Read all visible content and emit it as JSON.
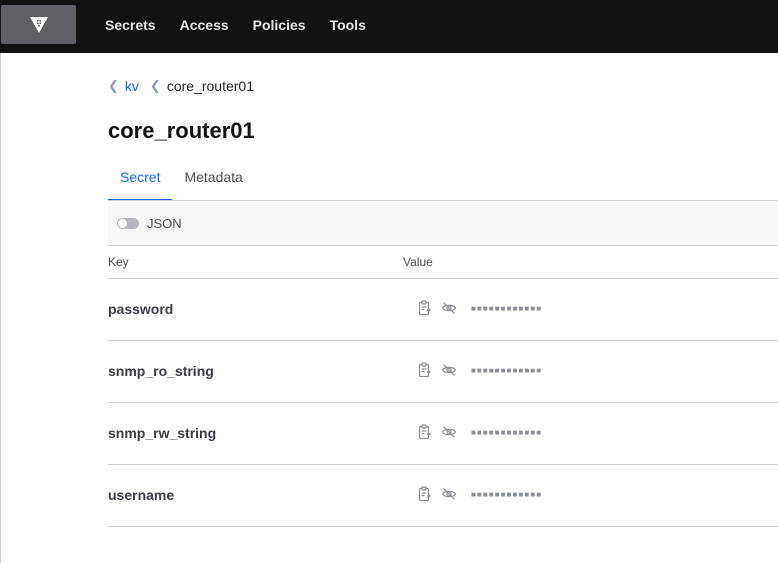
{
  "nav": {
    "logo": "vault-logo",
    "items": [
      "Secrets",
      "Access",
      "Policies",
      "Tools"
    ]
  },
  "breadcrumb": {
    "parent": "kv",
    "current": "core_router01"
  },
  "page": {
    "title": "core_router01"
  },
  "tabs": [
    {
      "label": "Secret",
      "active": true
    },
    {
      "label": "Metadata",
      "active": false
    }
  ],
  "toolbar": {
    "json_toggle_label": "JSON",
    "json_toggle_on": false
  },
  "table": {
    "headers": {
      "key": "Key",
      "value": "Value"
    },
    "rows": [
      {
        "key": "password",
        "masked_value": "■■■■■■■■■■■■"
      },
      {
        "key": "snmp_ro_string",
        "masked_value": "■■■■■■■■■■■■"
      },
      {
        "key": "snmp_rw_string",
        "masked_value": "■■■■■■■■■■■■"
      },
      {
        "key": "username",
        "masked_value": "■■■■■■■■■■■■"
      }
    ]
  },
  "colors": {
    "topbar": "#111212",
    "accent": "#1563ff",
    "border": "#cfd2d6"
  }
}
